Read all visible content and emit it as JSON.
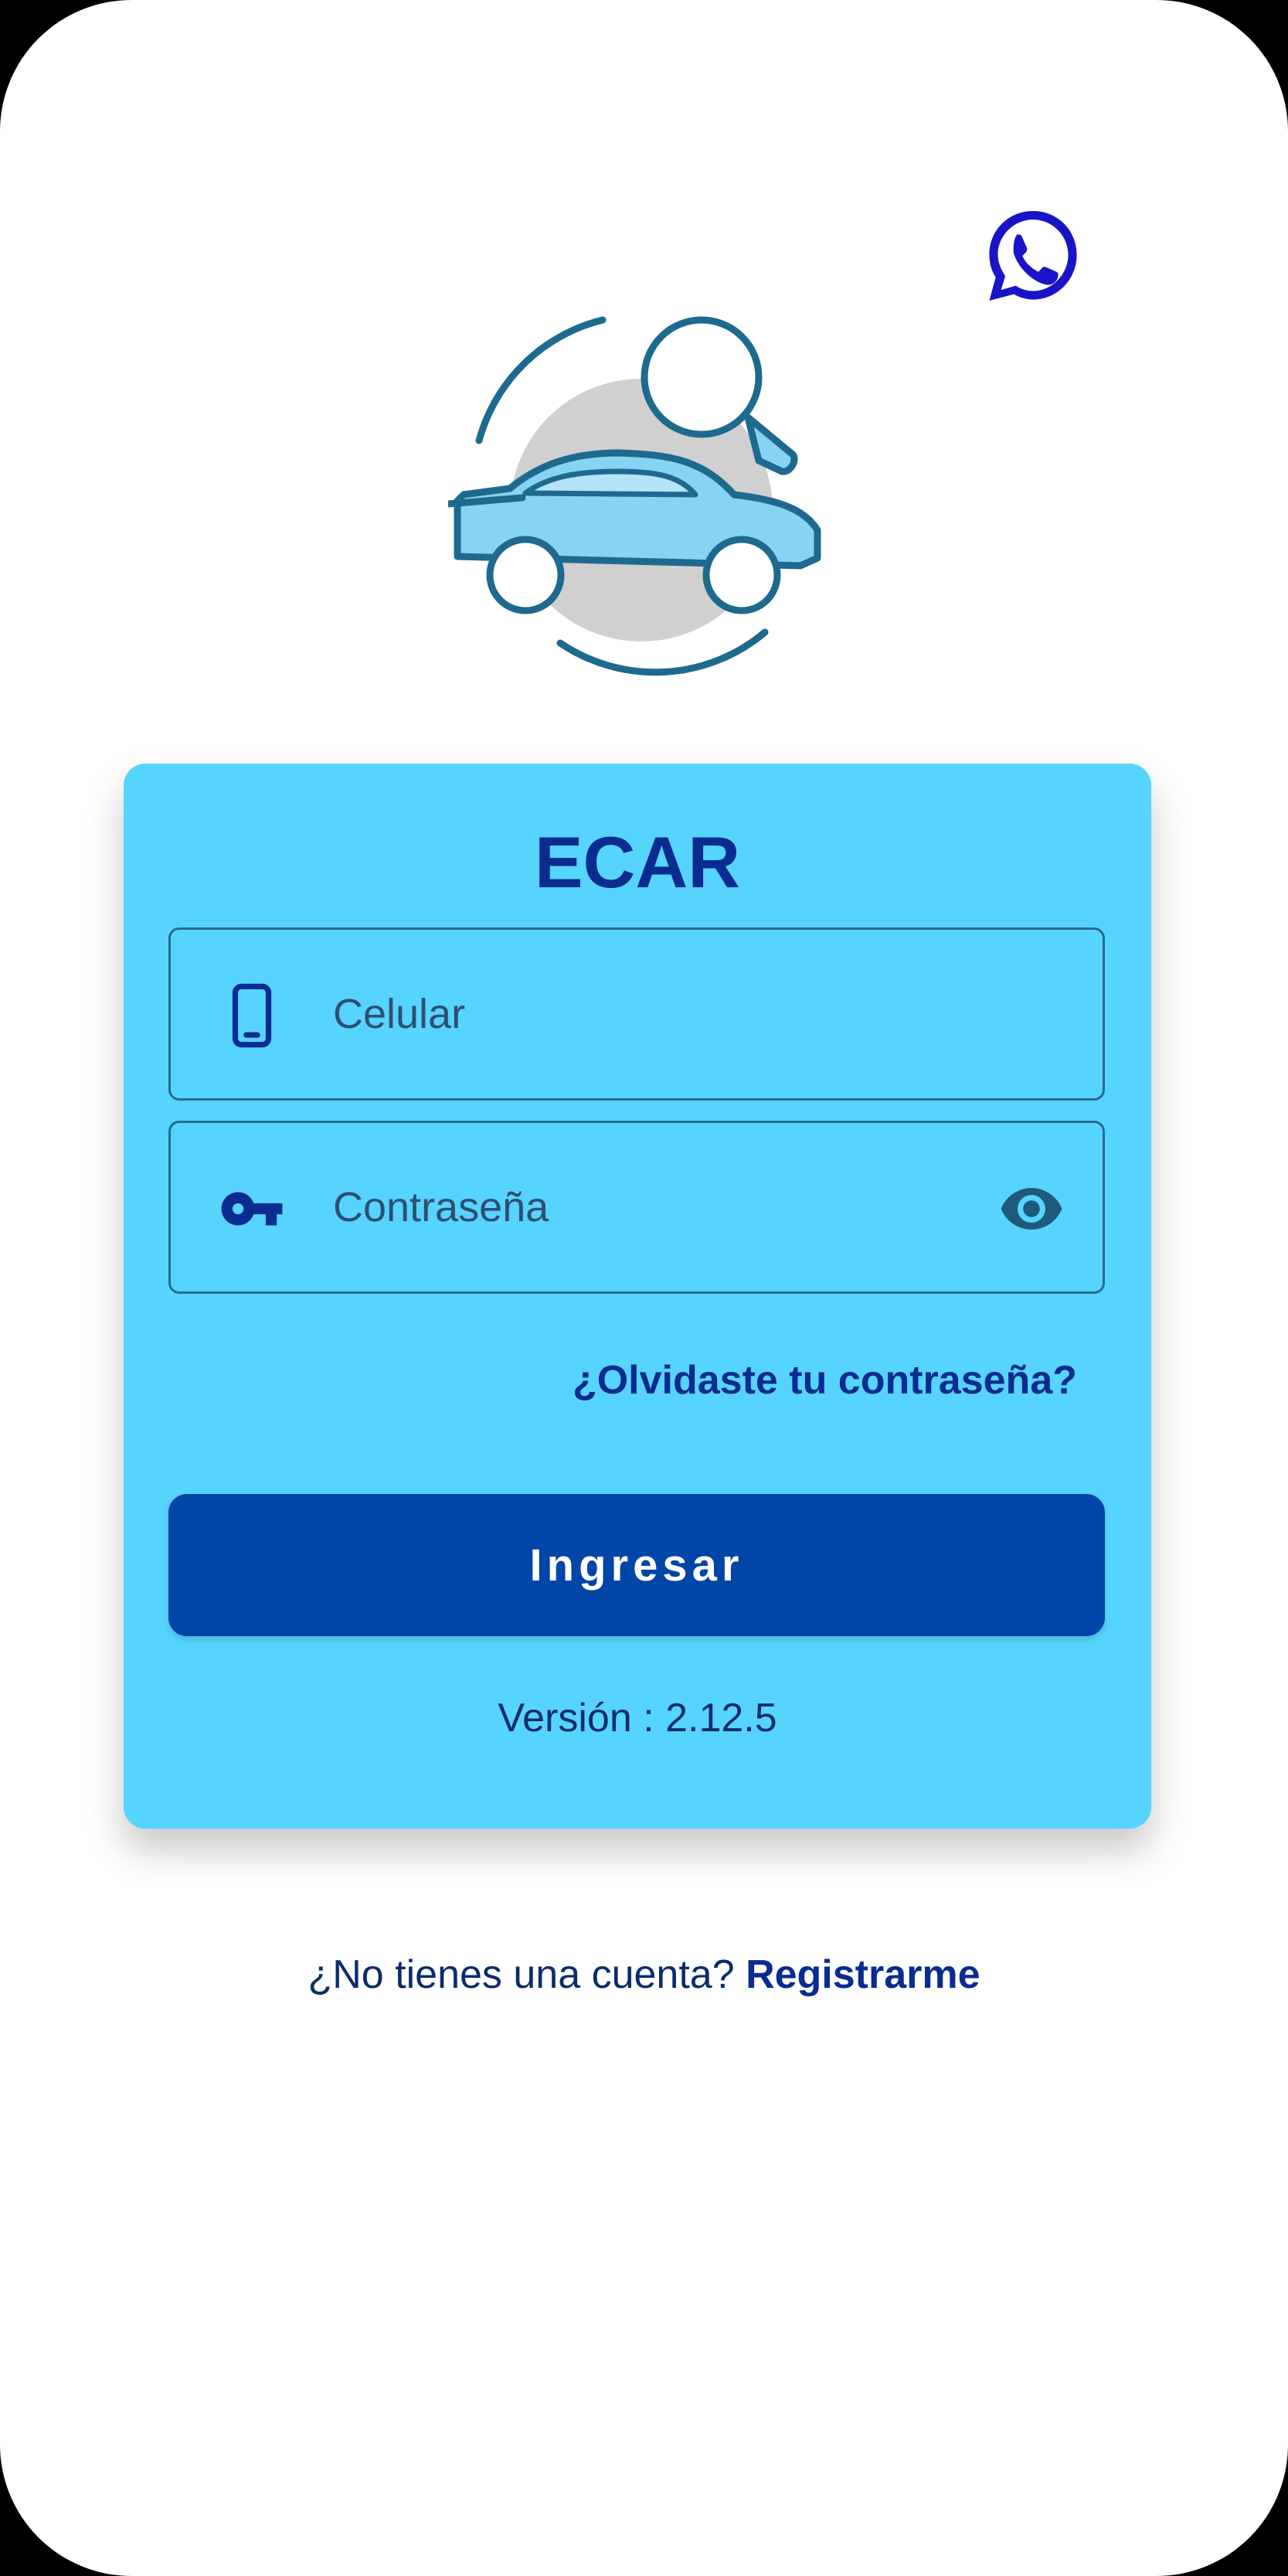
{
  "header": {
    "whatsapp_icon": "whatsapp-icon"
  },
  "logo": {
    "icon": "car-search-logo"
  },
  "login_card": {
    "title": "ECAR",
    "phone_field": {
      "icon": "mobile-phone-icon",
      "placeholder": "Celular",
      "value": ""
    },
    "password_field": {
      "icon": "key-icon",
      "placeholder": "Contraseña",
      "value": "",
      "toggle_icon": "eye-icon"
    },
    "forgot_password_label": "¿Olvidaste tu contraseña?",
    "submit_label": "Ingresar",
    "version_text": "Versión : 2.12.5"
  },
  "footer": {
    "prompt_text": "¿No tienes una cuenta?",
    "register_label": "Registrarme"
  },
  "colors": {
    "card_background": "#57d4fd",
    "primary_button": "#0045a8",
    "title_text": "#0a2b8f",
    "whatsapp_icon": "#1a14c8"
  }
}
